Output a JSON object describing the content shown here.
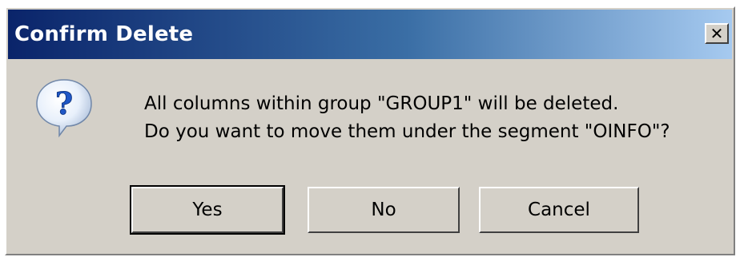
{
  "dialog": {
    "title": "Confirm Delete",
    "close_glyph": "×",
    "icon": "question-icon",
    "message_line1": "All columns within group \"GROUP1\" will be deleted.",
    "message_line2": "Do you want to move them under the segment \"OINFO\"?"
  },
  "buttons": {
    "yes_label": "Yes",
    "no_label": "No",
    "cancel_label": "Cancel"
  },
  "colors": {
    "title_gradient_start": "#0a246a",
    "title_gradient_end": "#a6caf0",
    "dialog_face": "#d4d0c8",
    "icon_blue": "#1f57c6"
  }
}
